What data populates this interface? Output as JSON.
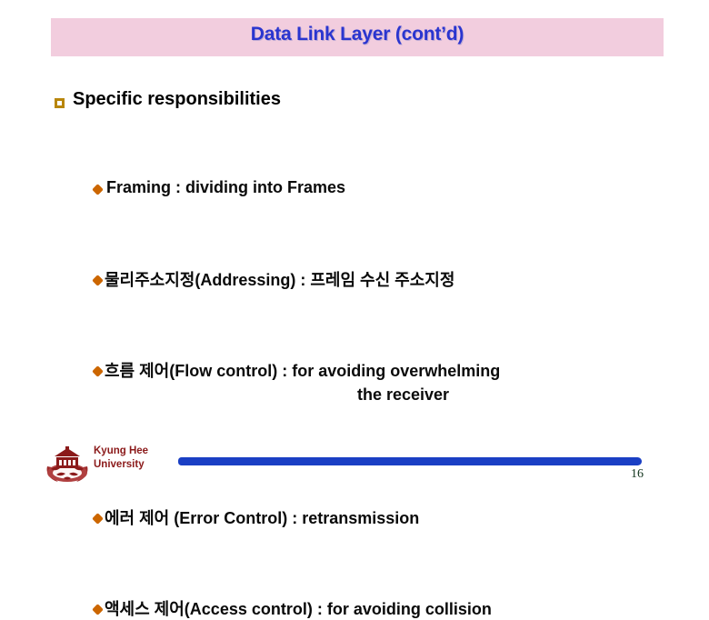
{
  "slide": {
    "title": "Data Link Layer (cont’d)",
    "title_band_color": "#f2cdde",
    "title_color": "#2a35cf",
    "heading": {
      "bullet_icon": "hollow-square-bullet",
      "bullet_color": "#b8860b",
      "text": "Specific responsibilities"
    },
    "items": [
      {
        "bullet_icon": "diamond-bullet",
        "bullet_color": "#cc6600",
        "text": "Framing : dividing into Frames",
        "continuation": ""
      },
      {
        "bullet_icon": "diamond-bullet",
        "bullet_color": "#cc6600",
        "text": "물리주소지정(Addressing) : 프레임 수신 주소지정",
        "continuation": ""
      },
      {
        "bullet_icon": "diamond-bullet",
        "bullet_color": "#cc6600",
        "text": "흐름 제어(Flow control) : for avoiding overwhelming",
        "continuation": "the receiver"
      },
      {
        "bullet_icon": "diamond-bullet",
        "bullet_color": "#cc6600",
        "text": "에러 제어 (Error Control) : retransmission",
        "continuation": ""
      },
      {
        "bullet_icon": "diamond-bullet",
        "bullet_color": "#cc6600",
        "text": "액세스 제어(Access control) : for avoiding collision",
        "continuation": ""
      }
    ]
  },
  "footer": {
    "logo_icon": "kyung-hee-university-crest-icon",
    "logo_color": "#8b1a1a",
    "org_line1": "Kyung Hee",
    "org_line2": "University",
    "rule_color": "#1a3fc4",
    "page_number": "16"
  }
}
